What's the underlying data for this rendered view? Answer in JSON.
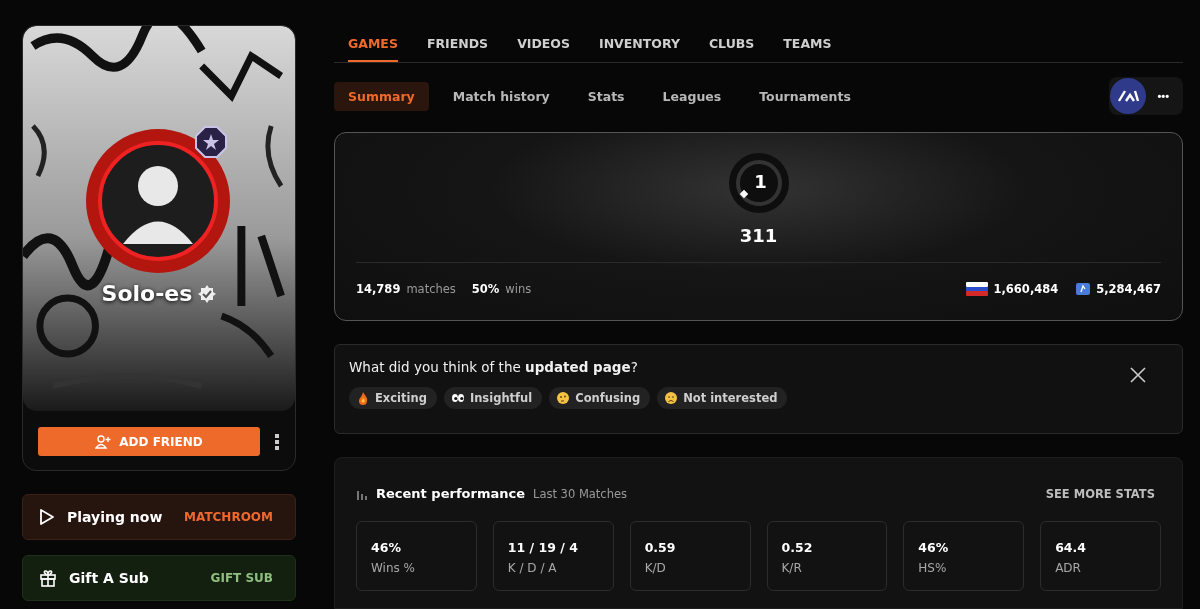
{
  "profile": {
    "name": "Solo-es",
    "verified": true,
    "add_friend": "ADD FRIEND"
  },
  "actions": [
    {
      "kind": "playing",
      "label": "Playing now",
      "action": "MATCHROOM"
    },
    {
      "kind": "gift",
      "label": "Gift A Sub",
      "action": "GIFT SUB"
    }
  ],
  "tabs": [
    {
      "label": "GAMES",
      "selected": true
    },
    {
      "label": "FRIENDS",
      "selected": false
    },
    {
      "label": "VIDEOS",
      "selected": false
    },
    {
      "label": "INVENTORY",
      "selected": false
    },
    {
      "label": "CLUBS",
      "selected": false
    },
    {
      "label": "TEAMS",
      "selected": false
    }
  ],
  "subtabs": [
    {
      "label": "Summary",
      "selected": true
    },
    {
      "label": "Match history",
      "selected": false
    },
    {
      "label": "Stats",
      "selected": false
    },
    {
      "label": "Leagues",
      "selected": false
    },
    {
      "label": "Tournaments",
      "selected": false
    }
  ],
  "more_menu": "•••",
  "summary": {
    "skill_level": "1",
    "elo": "311",
    "matches": "14,789",
    "matches_label": "matches",
    "wins": "50%",
    "wins_label": "wins",
    "country_rank": "1,660,484",
    "region_rank": "5,284,467"
  },
  "feedback": {
    "question": "What did you think of the **updated page**?",
    "options": [
      {
        "kind": "fire",
        "label": "Exciting"
      },
      {
        "kind": "eyes",
        "label": "Insightful"
      },
      {
        "kind": "thinking",
        "label": "Confusing"
      },
      {
        "kind": "sad",
        "label": "Not interested"
      }
    ]
  },
  "performance": {
    "title": "Recent performance",
    "subtitle": "Last 30 Matches",
    "link": "SEE MORE STATS",
    "stats": [
      {
        "value": "46%",
        "label": "Wins %"
      },
      {
        "value": "11 / 19 / 4",
        "label": "K / D / A"
      },
      {
        "value": "0.59",
        "label": "K/D"
      },
      {
        "value": "0.52",
        "label": "K/R"
      },
      {
        "value": "46%",
        "label": "HS%"
      },
      {
        "value": "64.4",
        "label": "ADR"
      }
    ]
  }
}
